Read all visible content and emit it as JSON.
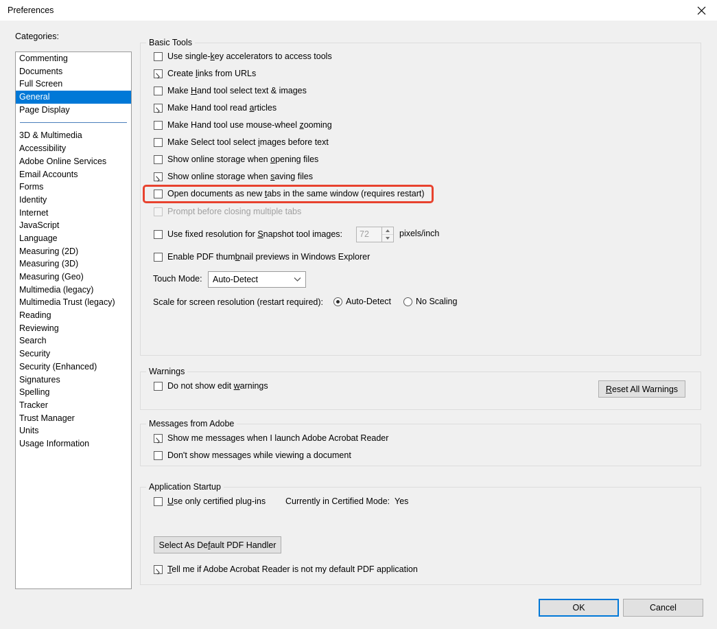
{
  "window": {
    "title": "Preferences",
    "close_icon": "close-icon"
  },
  "categories": {
    "label": "Categories:",
    "selected": "General",
    "group_a": [
      "Commenting",
      "Documents",
      "Full Screen",
      "General",
      "Page Display"
    ],
    "group_b": [
      "3D & Multimedia",
      "Accessibility",
      "Adobe Online Services",
      "Email Accounts",
      "Forms",
      "Identity",
      "Internet",
      "JavaScript",
      "Language",
      "Measuring (2D)",
      "Measuring (3D)",
      "Measuring (Geo)",
      "Multimedia (legacy)",
      "Multimedia Trust (legacy)",
      "Reading",
      "Reviewing",
      "Search",
      "Security",
      "Security (Enhanced)",
      "Signatures",
      "Spelling",
      "Tracker",
      "Trust Manager",
      "Units",
      "Usage Information"
    ]
  },
  "basic_tools": {
    "title": "Basic Tools",
    "checkboxes": [
      {
        "pre": "Use single-",
        "acc": "k",
        "post": "ey accelerators to access tools",
        "checked": false,
        "enabled": true
      },
      {
        "pre": "Create ",
        "acc": "l",
        "post": "inks from URLs",
        "checked": true,
        "enabled": true
      },
      {
        "pre": "Make ",
        "acc": "H",
        "post": "and tool select text & images",
        "checked": false,
        "enabled": true
      },
      {
        "pre": "Make Hand tool read ",
        "acc": "a",
        "post": "rticles",
        "checked": true,
        "enabled": true
      },
      {
        "pre": "Make Hand tool use mouse-wheel ",
        "acc": "z",
        "post": "ooming",
        "checked": false,
        "enabled": true
      },
      {
        "pre": "Make Select tool select ",
        "acc": "i",
        "post": "mages before text",
        "checked": false,
        "enabled": true
      },
      {
        "pre": "Show online storage when ",
        "acc": "o",
        "post": "pening files",
        "checked": false,
        "enabled": true
      },
      {
        "pre": "Show online storage when ",
        "acc": "s",
        "post": "aving files",
        "checked": true,
        "enabled": true
      },
      {
        "pre": "Open documents as new ",
        "acc": "t",
        "post": "abs in the same window (requires restart)",
        "checked": false,
        "enabled": true
      },
      {
        "pre": "Prompt before closing multiple tabs",
        "acc": "",
        "post": "",
        "checked": false,
        "enabled": false
      },
      {
        "pre": "Use fixed resolution for ",
        "acc": "S",
        "post": "napshot tool images:",
        "checked": false,
        "enabled": true
      },
      {
        "pre": "Enable PDF thum",
        "acc": "b",
        "post": "nail previews in Windows Explorer",
        "checked": false,
        "enabled": true
      }
    ],
    "snapshot_resolution": {
      "value": "72",
      "units": "pixels/inch"
    },
    "touch_mode": {
      "label": "Touch Mode:",
      "value": "Auto-Detect",
      "arrow_icon": "chevron-down-icon"
    },
    "scale": {
      "label": "Scale for screen resolution (restart required):",
      "options": [
        {
          "label": "Auto-Detect",
          "selected": true
        },
        {
          "label": "No Scaling",
          "selected": false
        }
      ]
    }
  },
  "warnings": {
    "title": "Warnings",
    "checkbox": {
      "pre": "Do not show edit ",
      "acc": "w",
      "post": "arnings",
      "checked": false
    },
    "reset_button": {
      "pre": "",
      "acc": "R",
      "post": "eset All Warnings"
    }
  },
  "messages_from_adobe": {
    "title": "Messages from Adobe",
    "checkboxes": [
      {
        "pre": "Show me messages when I launch Adobe Acrobat Reader",
        "acc": "",
        "post": "",
        "checked": true
      },
      {
        "pre": "Don't show messages while viewing a document",
        "acc": "",
        "post": "",
        "checked": false
      }
    ]
  },
  "application_startup": {
    "title": "Application Startup",
    "plugins_checkbox": {
      "pre": "",
      "acc": "U",
      "post": "se only certified plug-ins",
      "checked": false
    },
    "certified_mode_label": "Currently in Certified Mode:",
    "certified_mode_value": "Yes",
    "default_handler_button": {
      "pre": "Select As De",
      "acc": "f",
      "post": "ault PDF Handler"
    },
    "default_app_checkbox": {
      "pre": "",
      "acc": "T",
      "post": "ell me if Adobe Acrobat Reader is not my default PDF application",
      "checked": true
    }
  },
  "footer": {
    "ok": "OK",
    "cancel": "Cancel"
  },
  "colors": {
    "selection_blue": "#0078d7",
    "highlight_red": "#e8422e",
    "dialog_bg": "#f0f0f0"
  }
}
